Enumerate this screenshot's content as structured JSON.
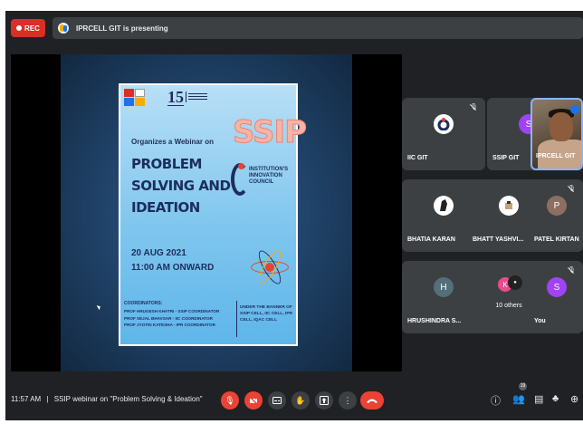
{
  "top_bar": {
    "rec_label": "REC",
    "presenting_text": "IPRCELL GIT is presenting"
  },
  "slide": {
    "badge_number": "15",
    "ssip_logo": "SSIP",
    "organizes": "Organizes a Webinar on",
    "title_lines": [
      "PROBLEM",
      "SOLVING AND",
      "IDEATION"
    ],
    "iic_text": "INSTITUTION'S INNOVATION COUNCIL",
    "date": "20 AUG 2021",
    "time": "11:00 AM ONWARD",
    "coordinators_title": "COORDINATORS:",
    "coordinators": [
      "PROF HRUGESH KHATRI - SSIP COORDINATOR",
      "PROF SEJAL BHAVSAR - IIC COORDINATOR",
      "PROF JYOTIN KATESHA - IPR COORDINATOR"
    ],
    "banner": "UNDER THE BANNER OF SSIP CELL, IIC CELL, IPR CELL, IQAC CELL"
  },
  "participants": [
    {
      "name": "IIC GIT",
      "avatar": "",
      "color": "#ffffff"
    },
    {
      "name": "SSIP GIT",
      "avatar": "S",
      "color": "#a142f4"
    },
    {
      "name": "IPRCELL GIT",
      "avatar": "",
      "color": "#8ab4f8"
    },
    {
      "name": "BHATIA KARAN",
      "avatar": "",
      "color": "#ffffff"
    },
    {
      "name": "BHATT YASHVI...",
      "avatar": "",
      "color": "#ffffff"
    },
    {
      "name": "PATEL KIRTAN",
      "avatar": "P",
      "color": "#8d6e63"
    },
    {
      "name": "HRUSHINDRA S...",
      "avatar": "H",
      "color": "#546e7a"
    },
    {
      "name": "10 others",
      "avatar": "K",
      "color": "#ea4c89"
    },
    {
      "name": "You",
      "avatar": "S",
      "color": "#a142f4"
    }
  ],
  "bottom_bar": {
    "time": "11:57 AM",
    "separator": "|",
    "meeting_title": "SSIP webinar on \"Problem Solving & Ideation\"",
    "participant_count": "19"
  }
}
